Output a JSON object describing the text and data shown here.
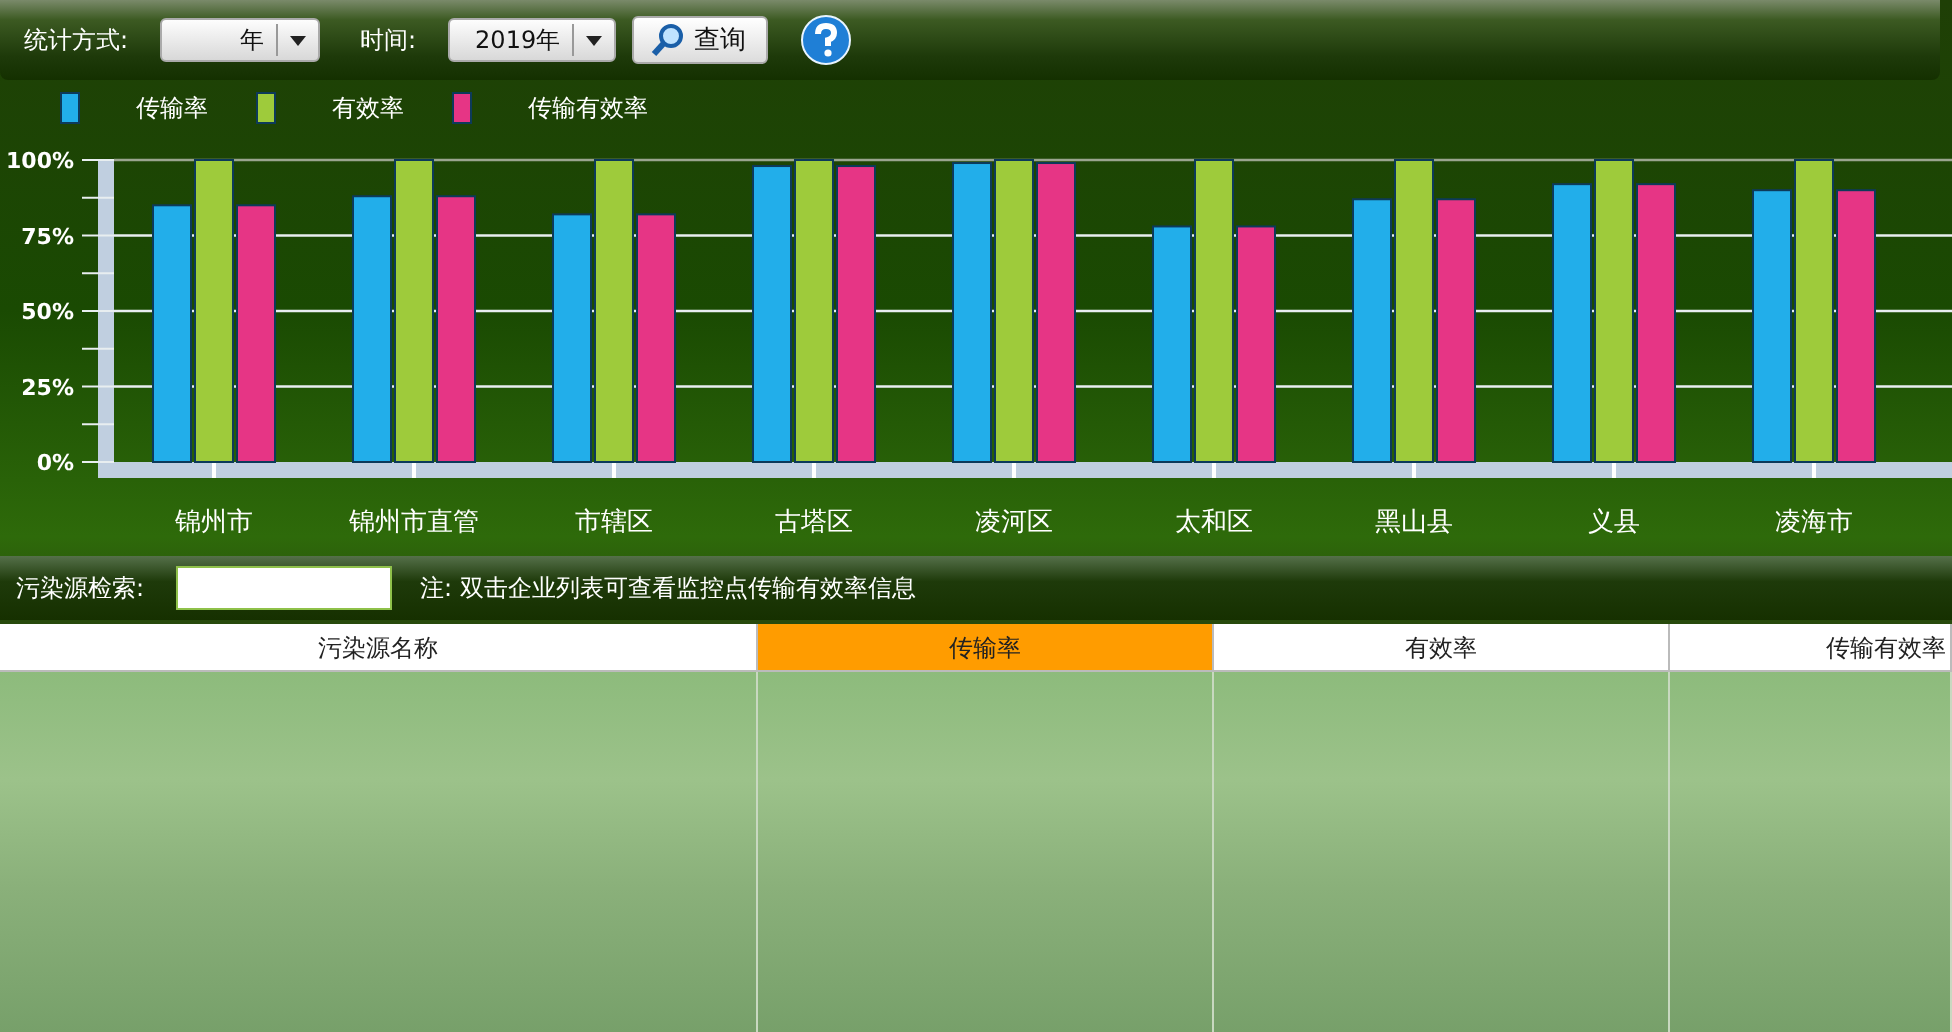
{
  "toolbar": {
    "stat_label": "统计方式:",
    "stat_value": "年",
    "time_label": "时间:",
    "time_value": "2019年",
    "query_button": "查询"
  },
  "chart": {
    "chart_data": {
      "type": "bar",
      "categories": [
        "锦州市",
        "锦州市直管",
        "市辖区",
        "古塔区",
        "凌河区",
        "太和区",
        "黑山县",
        "义县",
        "凌海市"
      ],
      "series": [
        {
          "name": "传输率",
          "color": "#22aeea",
          "values": [
            85,
            88,
            82,
            98,
            99,
            78,
            87,
            92,
            90
          ]
        },
        {
          "name": "有效率",
          "color": "#9ecb3b",
          "values": [
            100,
            100,
            100,
            100,
            100,
            100,
            100,
            100,
            100
          ]
        },
        {
          "name": "传输有效率",
          "color": "#e63585",
          "values": [
            85,
            88,
            82,
            98,
            99,
            78,
            87,
            92,
            90
          ]
        }
      ],
      "grid": true,
      "ylim": [
        0,
        100
      ],
      "yticks": [
        {
          "value": 0,
          "label": "0%"
        },
        {
          "value": 25,
          "label": "25%"
        },
        {
          "value": 50,
          "label": "50%"
        },
        {
          "value": 75,
          "label": "75%"
        },
        {
          "value": 100,
          "label": "100%"
        }
      ]
    }
  },
  "search": {
    "label": "污染源检索:",
    "note": "注: 双击企业列表可查看监控点传输有效率信息"
  },
  "table": {
    "columns": [
      {
        "label": "污染源名称",
        "selected": false
      },
      {
        "label": "传输率",
        "selected": true
      },
      {
        "label": "有效率",
        "selected": false
      },
      {
        "label": "传输有效率",
        "selected": false
      }
    ]
  }
}
